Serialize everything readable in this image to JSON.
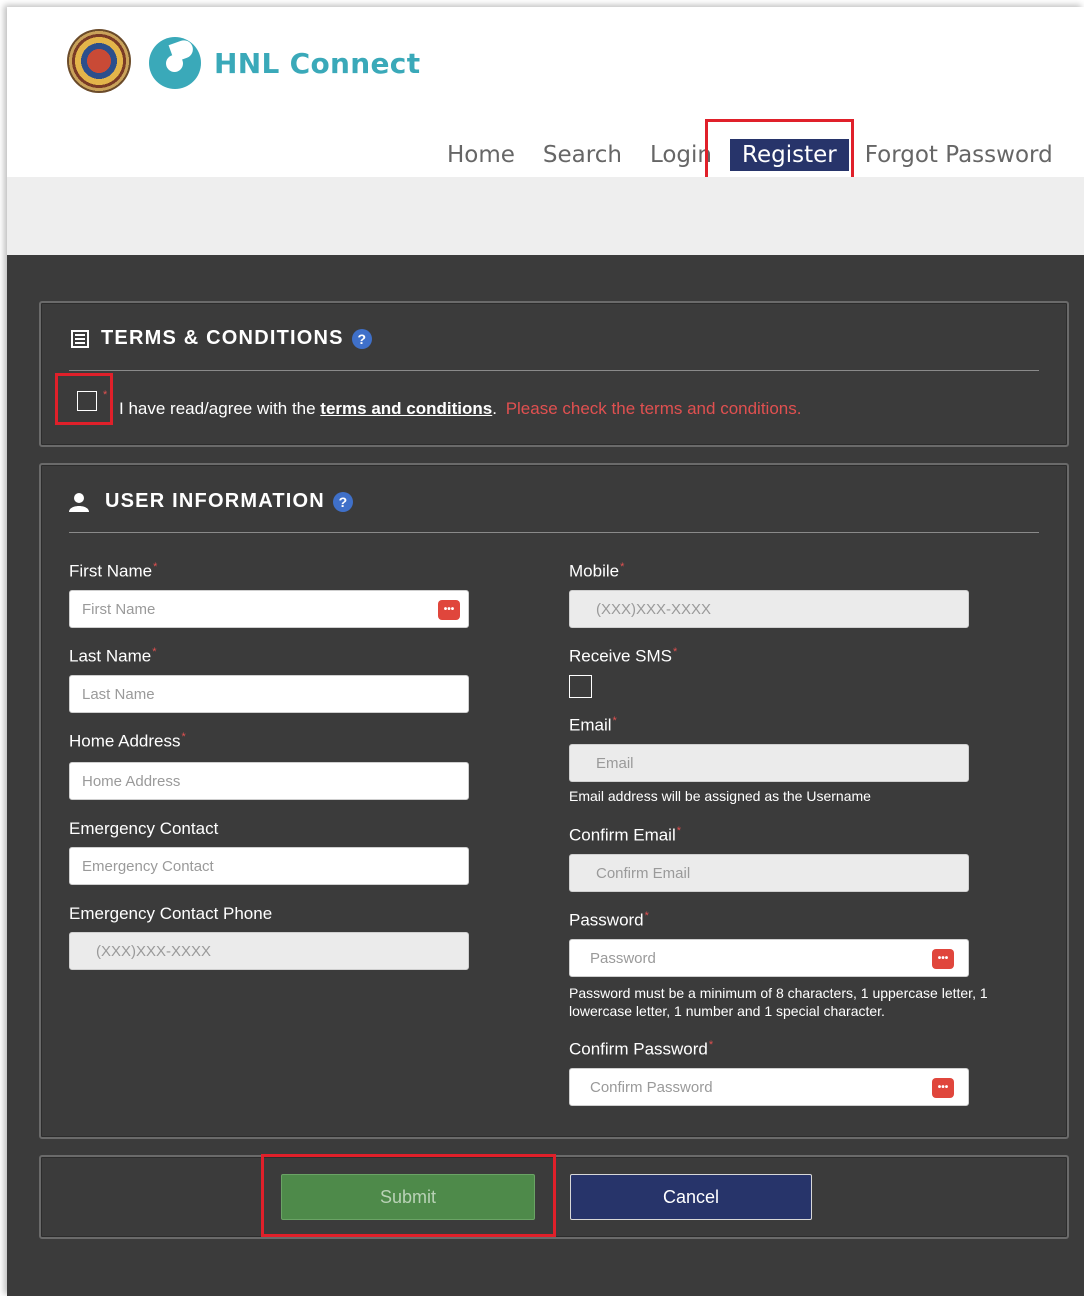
{
  "brand": {
    "name": "HNL Connect"
  },
  "nav": {
    "home": "Home",
    "search": "Search",
    "login": "Login",
    "register": "Register",
    "forgot": "Forgot Password"
  },
  "terms": {
    "title": "TERMS & CONDITIONS",
    "help": "?",
    "agree_prefix": "I have read/agree with the ",
    "agree_link": "terms and conditions",
    "agree_suffix": ".",
    "error": "Please check the terms and conditions."
  },
  "user_info": {
    "title": "USER INFORMATION",
    "help": "?",
    "required_mark": "*",
    "first_name": {
      "label": "First Name",
      "placeholder": "First Name"
    },
    "last_name": {
      "label": "Last Name",
      "placeholder": "Last Name"
    },
    "home_address": {
      "label": "Home Address",
      "placeholder": "Home Address"
    },
    "emergency_contact": {
      "label": "Emergency Contact",
      "placeholder": "Emergency Contact"
    },
    "emergency_phone": {
      "label": "Emergency Contact Phone",
      "placeholder": "(XXX)XXX-XXXX"
    },
    "mobile": {
      "label": "Mobile",
      "placeholder": "(XXX)XXX-XXXX"
    },
    "receive_sms": {
      "label": "Receive SMS"
    },
    "email": {
      "label": "Email",
      "placeholder": "Email",
      "hint": "Email address will be assigned as the Username"
    },
    "confirm_email": {
      "label": "Confirm Email",
      "placeholder": "Confirm Email"
    },
    "password": {
      "label": "Password",
      "placeholder": "Password",
      "hint": "Password must be a minimum of 8 characters, 1 uppercase letter, 1 lowercase letter, 1 number and 1 special character."
    },
    "confirm_password": {
      "label": "Confirm Password",
      "placeholder": "Confirm Password"
    },
    "kb_icon_glyph": "•••"
  },
  "actions": {
    "submit": "Submit",
    "cancel": "Cancel"
  },
  "colors": {
    "teal": "#3aa9b9",
    "navy": "#27346a",
    "highlight_red": "#e0202a",
    "submit_green": "#4e8a4a",
    "panel_bg": "#3b3b3b"
  },
  "icons": {
    "terms": "document-list-icon",
    "user": "user-icon",
    "keyboard": "input-helper-icon"
  }
}
